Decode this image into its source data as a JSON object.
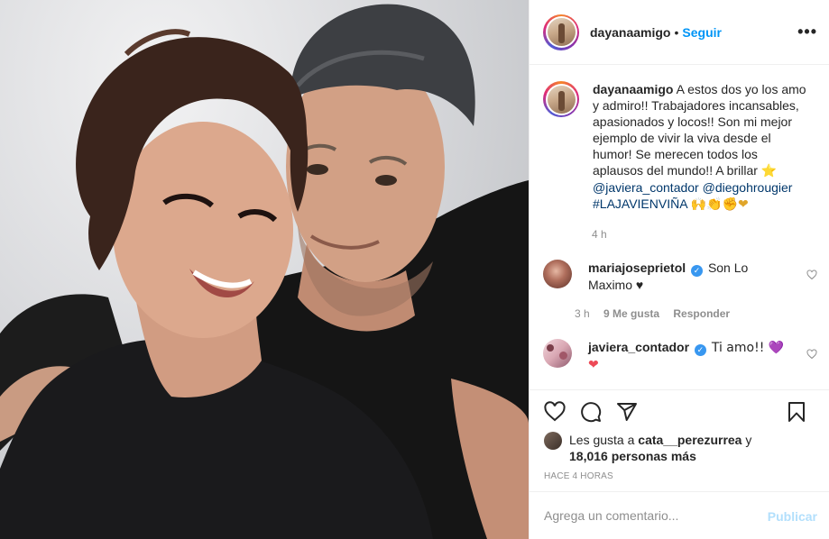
{
  "header": {
    "username": "dayanaamigo",
    "separator": "•",
    "follow_label": "Seguir",
    "more_label": "•••"
  },
  "caption": {
    "username": "dayanaamigo",
    "text": "A estos dos yo los amo y admiro!! Trabajadores incansables, apasionados y locos!! Son mi mejor ejemplo de vivir la viva desde el humor! Se merecen todos los aplausos del mundo!! A brillar",
    "star_emoji": "⭐",
    "mention_1": "@javiera_contador",
    "mention_2": "@diegohrougier",
    "hashtag": "#LAJAVIENVIÑA",
    "emojis_tail": "🙌👏✊❤",
    "time": "4 h"
  },
  "comments": [
    {
      "username": "mariajoseprietol",
      "verified_glyph": "✓",
      "text": "Son Lo Maximo ♥",
      "time": "3 h",
      "likes": "9 Me gusta",
      "reply_label": "Responder"
    },
    {
      "username": "javiera_contador",
      "verified_glyph": "✓",
      "text": "Ti amo!! 💜",
      "second_line": "❤"
    }
  ],
  "actions": {
    "icons": [
      "heart-icon",
      "comment-icon",
      "share-icon",
      "bookmark-icon"
    ],
    "liked_by_prefix": "Les gusta a",
    "liked_by_user": "cata__perezurrea",
    "liked_by_and": "y",
    "likes_count": "18,016 personas más",
    "time_ago": "HACE 4 HORAS"
  },
  "add_comment": {
    "placeholder": "Agrega un comentario...",
    "publish_label": "Publicar"
  },
  "colors": {
    "accent": "#0095f6",
    "mention": "#00376b",
    "muted": "#8e8e8e",
    "border": "#efefef",
    "publish_disabled": "#b2dffc",
    "verified": "#3897f0",
    "heart_red": "#ed4956"
  }
}
